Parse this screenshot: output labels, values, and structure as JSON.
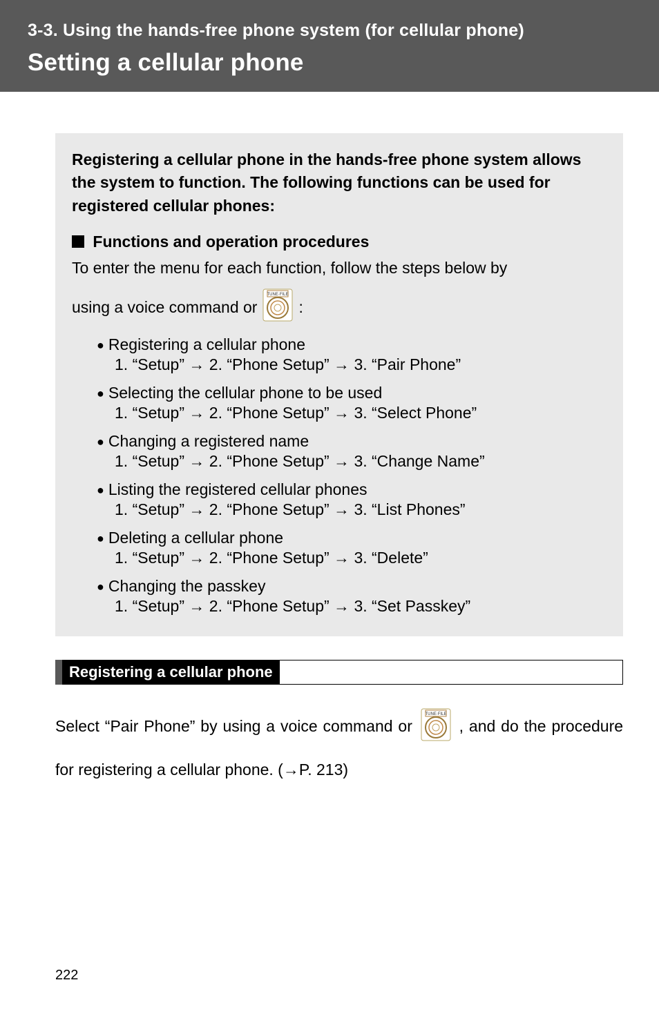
{
  "banner": {
    "sub": "3-3. Using the hands-free phone system (for cellular phone)",
    "title": "Setting a cellular phone"
  },
  "graybox": {
    "intro": "Registering a cellular phone in the hands-free phone system allows the system to function. The following functions can be used for registered cellular phones:",
    "subhead": "Functions and operation procedures",
    "lead": "To enter the menu for each function, follow the steps below by",
    "voice_prefix": "using a voice command or",
    "voice_suffix": ":",
    "items": [
      {
        "title": "Registering a cellular phone",
        "steps": "1. “Setup” → 2. “Phone Setup” → 3. “Pair Phone”"
      },
      {
        "title": "Selecting the cellular phone to be used",
        "steps": "1. “Setup” → 2. “Phone Setup” → 3. “Select Phone”"
      },
      {
        "title": "Changing a registered name",
        "steps": "1. “Setup” → 2. “Phone Setup” → 3. “Change Name”"
      },
      {
        "title": "Listing the registered cellular phones",
        "steps": "1. “Setup” → 2. “Phone Setup” → 3. “List Phones”"
      },
      {
        "title": "Deleting a cellular phone",
        "steps": "1. “Setup” → 2. “Phone Setup” → 3. “Delete”"
      },
      {
        "title": "Changing the passkey",
        "steps": "1. “Setup” → 2. “Phone Setup” → 3. “Set Passkey”"
      }
    ]
  },
  "section_bar": {
    "label": "Registering a cellular phone"
  },
  "body": {
    "part1": "Select “Pair Phone” by using a voice command or",
    "part2": ", and do the procedure for registering a cellular phone. (→P. 213)"
  },
  "page_number": "222",
  "icons": {
    "knob_label": "TUNE·FILE"
  }
}
